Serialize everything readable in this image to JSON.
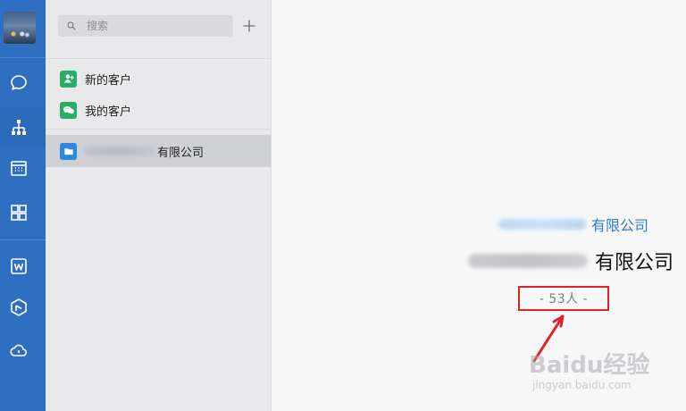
{
  "colors": {
    "rail_bg": "#2f6fc1",
    "mid_bg": "#e9e9ec",
    "right_bg": "#f7f7f8",
    "accent_blue": "#2f7bd0",
    "highlight_red": "#e0222e",
    "green_icon": "#2aae67",
    "blue_folder": "#2b87e6"
  },
  "rail": {
    "items": [
      {
        "name": "chat-icon"
      },
      {
        "name": "org-chart-icon",
        "active": true
      },
      {
        "name": "calendar-icon"
      },
      {
        "name": "apps-grid-icon"
      },
      {
        "name": "word-icon"
      },
      {
        "name": "cube-icon"
      },
      {
        "name": "cloud-icon"
      }
    ]
  },
  "search": {
    "placeholder": "搜索"
  },
  "menu": {
    "items": [
      {
        "label": "新的客户",
        "icon": "add-contact-icon"
      },
      {
        "label": "我的客户",
        "icon": "wechat-icon"
      }
    ]
  },
  "org": {
    "item": {
      "suffix": "有限公司",
      "icon": "folder-icon"
    }
  },
  "right": {
    "line1_suffix": "有限公司",
    "line2_suffix": "有限公司",
    "count": "- 53人 -"
  },
  "watermark": {
    "main": "Baidu经验",
    "sub": "jingyan.baidu.com"
  }
}
